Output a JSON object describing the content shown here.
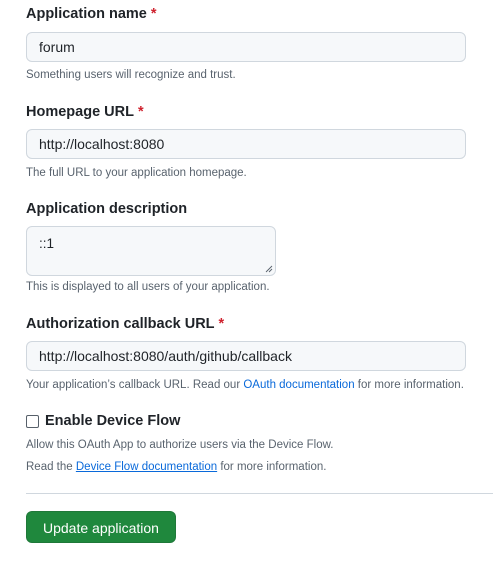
{
  "fields": {
    "app_name": {
      "label": "Application name",
      "required_mark": "*",
      "value": "forum",
      "note": "Something users will recognize and trust."
    },
    "homepage": {
      "label": "Homepage URL",
      "required_mark": "*",
      "value": "http://localhost:8080",
      "note": "The full URL to your application homepage."
    },
    "description": {
      "label": "Application description",
      "value": "::1",
      "note": "This is displayed to all users of your application."
    },
    "callback": {
      "label": "Authorization callback URL",
      "required_mark": "*",
      "value": "http://localhost:8080/auth/github/callback",
      "note_before": "Your application’s callback URL. Read our ",
      "note_link": "OAuth documentation",
      "note_after": " for more information."
    }
  },
  "device_flow": {
    "label": "Enable Device Flow",
    "checked": false,
    "note1": "Allow this OAuth App to authorize users via the Device Flow.",
    "note2_before": "Read the ",
    "note2_link": "Device Flow documentation",
    "note2_after": " for more information."
  },
  "submit": {
    "label": "Update application"
  },
  "colors": {
    "primary_button": "#1f883d",
    "link": "#0969da",
    "required": "#cf222e"
  }
}
